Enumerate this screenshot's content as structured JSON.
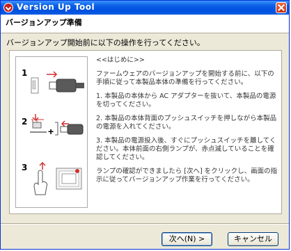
{
  "window": {
    "title": "Version Up Tool"
  },
  "header": {
    "title": "バージョンアップ準備"
  },
  "instruction": "バージョンアップ開始前に以下の操作を行ってください。",
  "steps": [
    {
      "number": "1"
    },
    {
      "number": "2"
    },
    {
      "number": "3"
    }
  ],
  "content": {
    "heading": "<<はじめに>>",
    "intro": "ファームウェアのバージョンアップを開始する前に、以下の手順に従って本製品本体の準備を行ってください。",
    "step1": "1. 本製品の本体から AC アダプターを抜いて、本製品の電源を切ってください。",
    "step2": "2. 本製品の本体背面のプッシュスイッチを押しながら本製品の電源を入れてください。",
    "step3": "3. 本製品の電源投入後、すぐにプッシュスイッチを離してください。本体前面の右側ランプが、赤点滅していることを確認してください。",
    "outro": "ランプの確認ができましたら [次へ] をクリックし、画面の指示に従ってバージョンアップ作業を行ってください。"
  },
  "buttons": {
    "next": "次へ(N) >",
    "cancel": "キャンセル"
  },
  "colors": {
    "titlebar": "#0a5fe4",
    "face": "#ece9d8",
    "accent_red": "#c8201a"
  }
}
